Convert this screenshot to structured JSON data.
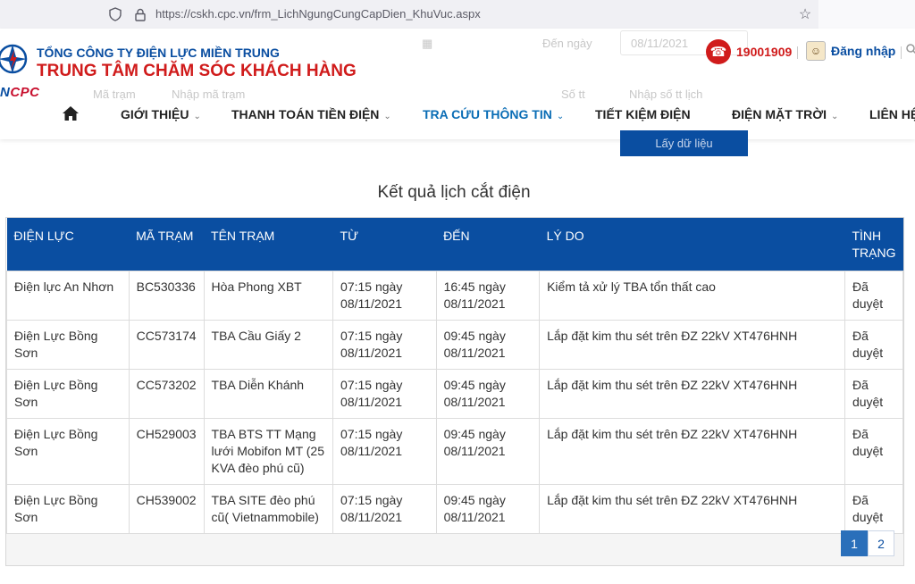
{
  "browser": {
    "url": "https://cskh.cpc.vn/frm_LichNgungCungCapDien_KhuVuc.aspx"
  },
  "header": {
    "logo_text_blue": "N",
    "logo_text_red": "CPC",
    "company": "TỔNG CÔNG TY ĐIỆN LỰC MIỀN TRUNG",
    "center": "TRUNG TÂM CHĂM SÓC KHÁCH HÀNG",
    "hotline": "19001909",
    "login": "Đăng nhập"
  },
  "ghost_form": {
    "den_ngay": "Đến ngày",
    "den_value": "08/11/2021",
    "ma_tram": "Mã trạm",
    "ma_tram_ph": "Nhập mã trạm",
    "so_tt": "Số tt",
    "so_tt_ph": "Nhập số tt lịch",
    "button": "Lấy dữ liệu"
  },
  "nav": {
    "items": [
      {
        "label": "GIỚI THIỆU",
        "chevron": true
      },
      {
        "label": "THANH TOÁN TIỀN ĐIỆN",
        "chevron": true
      },
      {
        "label": "TRA CỨU THÔNG TIN",
        "chevron": true,
        "active": true
      },
      {
        "label": "TIẾT KIỆM ĐIỆN",
        "chevron": false
      },
      {
        "label": "ĐIỆN MẶT TRỜI",
        "chevron": true
      },
      {
        "label": "LIÊN HỆ",
        "chevron": false
      }
    ]
  },
  "result_title": "Kết quả lịch cắt điện",
  "table": {
    "headers": [
      "ĐIỆN LỰC",
      "MÃ TRẠM",
      "TÊN TRẠM",
      "TỪ",
      "ĐẾN",
      "LÝ DO",
      "TÌNH TRẠNG"
    ],
    "rows": [
      [
        "Điện lực An Nhơn",
        "BC530336",
        "Hòa Phong XBT",
        "07:15 ngày 08/11/2021",
        "16:45 ngày 08/11/2021",
        "Kiểm tả xử lý TBA tổn thất cao",
        "Đã duyệt"
      ],
      [
        "Điện Lực Bồng Sơn",
        "CC573174",
        "TBA Cầu Giấy 2",
        "07:15 ngày 08/11/2021",
        "09:45 ngày 08/11/2021",
        "Lắp đặt kim thu sét trên ĐZ 22kV XT476HNH",
        "Đã duyệt"
      ],
      [
        "Điện Lực Bồng Sơn",
        "CC573202",
        "TBA Diễn Khánh",
        "07:15 ngày 08/11/2021",
        "09:45 ngày 08/11/2021",
        "Lắp đặt kim thu sét trên ĐZ 22kV XT476HNH",
        "Đã duyệt"
      ],
      [
        "Điện Lực Bồng Sơn",
        "CH529003",
        "TBA BTS TT Mạng lưới Mobifon MT (25 KVA đèo phú cũ)",
        "07:15 ngày 08/11/2021",
        "09:45 ngày 08/11/2021",
        "Lắp đặt kim thu sét trên ĐZ 22kV XT476HNH",
        "Đã duyệt"
      ],
      [
        "Điện Lực Bồng Sơn",
        "CH539002",
        "TBA SITE đèo phú cũ( Vietnammobile)",
        "07:15 ngày 08/11/2021",
        "09:45 ngày 08/11/2021",
        "Lắp đặt kim thu sét trên ĐZ 22kV XT476HNH",
        "Đã duyệt"
      ]
    ]
  },
  "pager": {
    "pages": [
      "1",
      "2"
    ],
    "current": "1"
  },
  "colors": {
    "brand_blue": "#0a4ea1",
    "brand_red": "#d01b1b",
    "active_nav": "#0a6db5"
  }
}
